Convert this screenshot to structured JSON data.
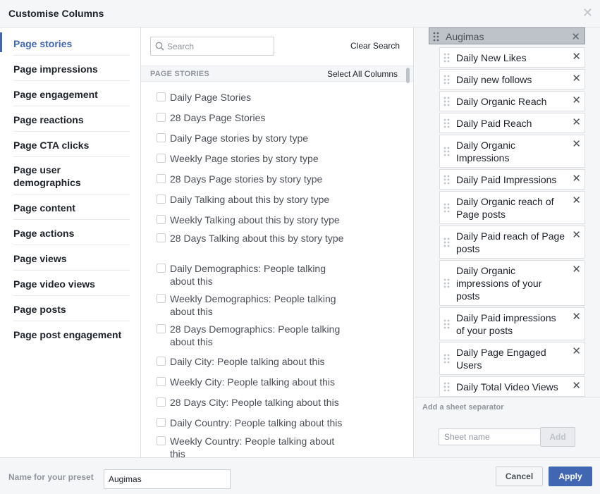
{
  "dialog": {
    "title": "Customise Columns"
  },
  "icons": {
    "close": "close-icon",
    "search": "search-icon",
    "drag": "drag-handle-icon",
    "remove": "remove-icon"
  },
  "colors": {
    "accent": "#4267b2",
    "panel": "#f5f6f7",
    "sheet_header": "#bec3c9"
  },
  "nav": {
    "selected": "Page stories",
    "items": [
      "Page stories",
      "Page impressions",
      "Page engagement",
      "Page reactions",
      "Page CTA clicks",
      "Page user demographics",
      "Page content",
      "Page actions",
      "Page views",
      "Page video views",
      "Page posts",
      "Page post engagement"
    ]
  },
  "search": {
    "placeholder": "Search",
    "value": "",
    "clear_label": "Clear Search"
  },
  "section": {
    "title": "PAGE STORIES",
    "select_all_label": "Select All Columns"
  },
  "options": [
    "Daily Page Stories",
    "28 Days Page Stories",
    "Daily Page stories by story type",
    "Weekly Page stories by story type",
    "28 Days Page stories by story type",
    "Daily Talking about this by story type",
    "Weekly Talking about this by story type",
    "28 Days Talking about this by story type",
    "Daily Demographics: People talking about this",
    "Weekly Demographics: People talking about this",
    "28 Days Demographics: People talking about this",
    "Daily City: People talking about this",
    "Weekly City: People talking about this",
    "28 Days City: People talking about this",
    "Daily Country: People talking about this",
    "Weekly Country: People talking about this"
  ],
  "selected_columns": {
    "sheet_name": "Augimas",
    "items": [
      "Daily New Likes",
      "Daily new follows",
      "Daily Organic Reach",
      "Daily Paid Reach",
      "Daily Organic Impressions",
      "Daily Paid Impressions",
      "Daily Organic reach of Page posts",
      "Daily Paid reach of Page posts",
      "Daily Organic impressions of your posts",
      "Daily Paid impressions of your posts",
      "Daily Page Engaged Users",
      "Daily Total Video Views"
    ]
  },
  "separator": {
    "title": "Add a sheet separator",
    "placeholder": "Sheet name",
    "add_label": "Add"
  },
  "footer": {
    "preset_label": "Name for your preset",
    "preset_value": "Augimas",
    "cancel_label": "Cancel",
    "apply_label": "Apply"
  }
}
